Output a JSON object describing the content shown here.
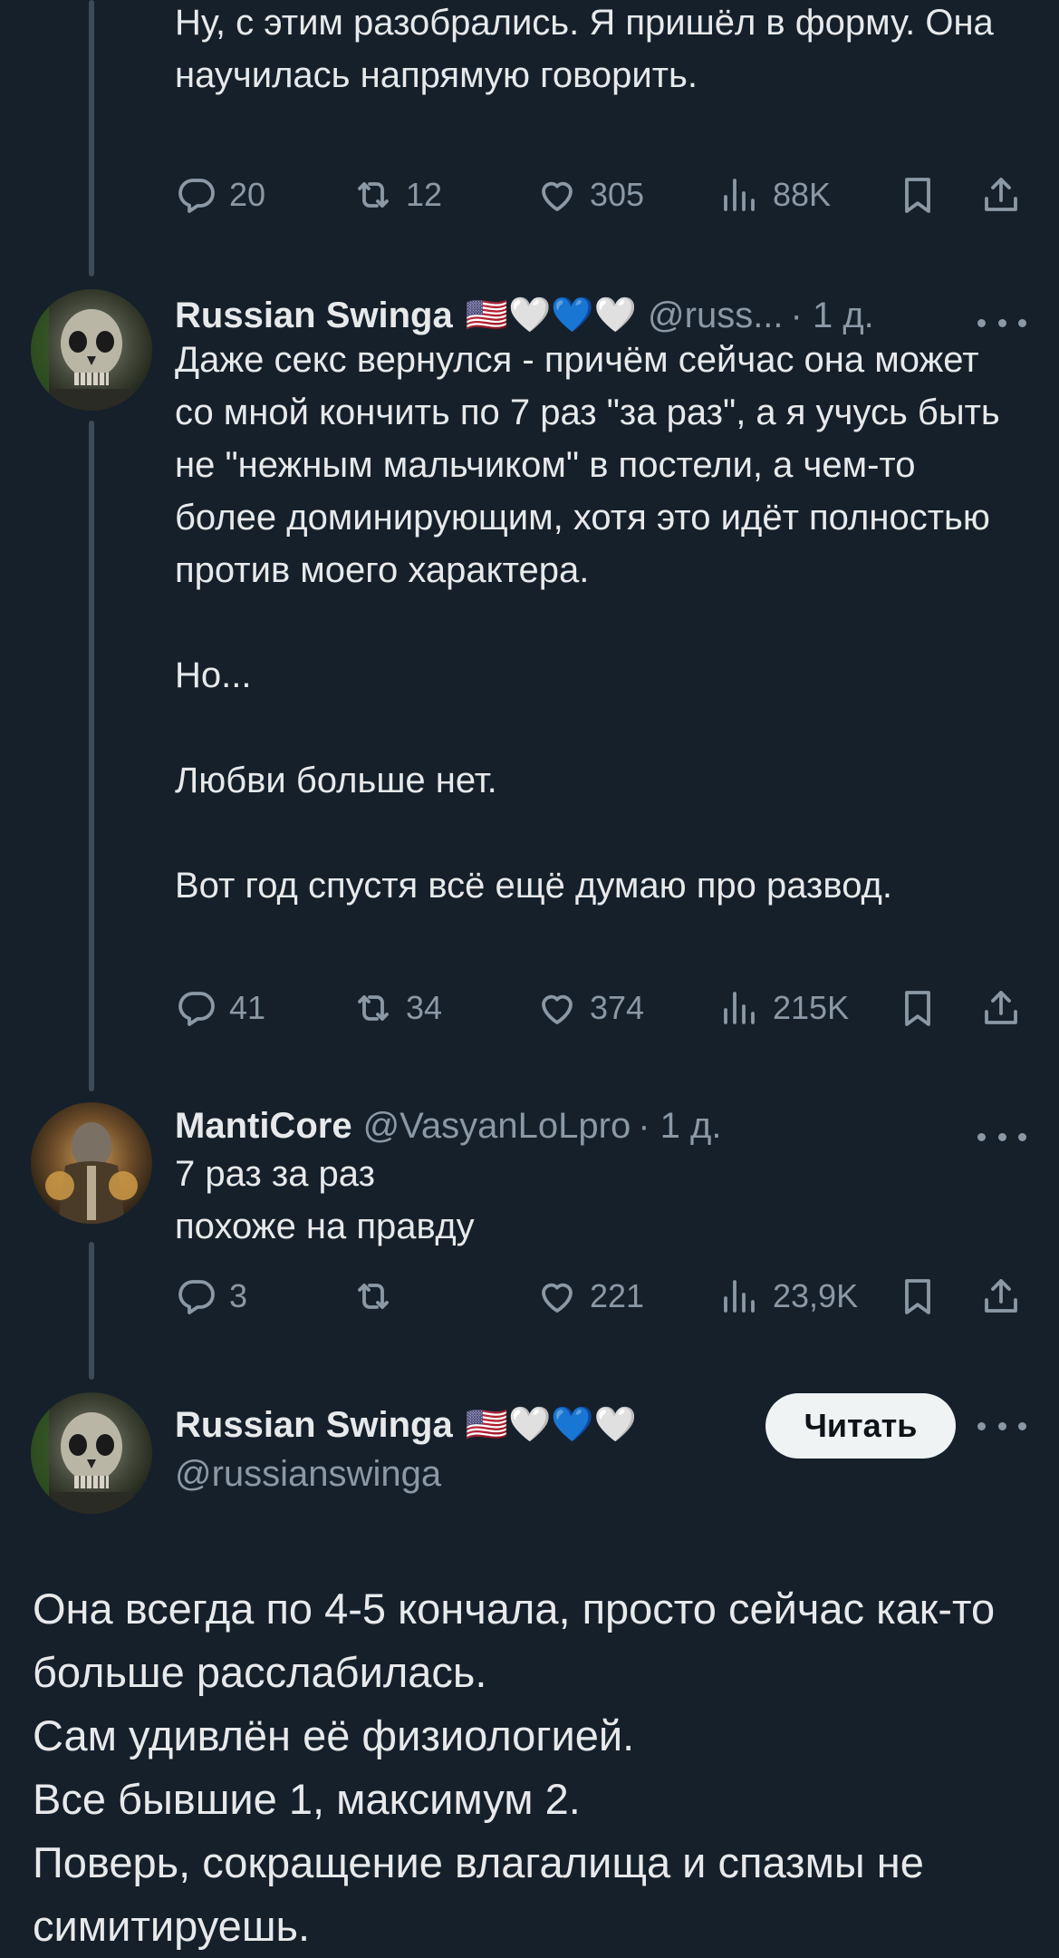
{
  "tweets": [
    {
      "text": "Ну, с этим разобрались. Я пришёл в форму. Она научилась напрямую говорить.",
      "counts": {
        "reply": "20",
        "retweet": "12",
        "like": "305",
        "views": "88K"
      }
    },
    {
      "name": "Russian Swinga",
      "flags": "🇺🇸🤍💙🤍",
      "handle": "@russ...",
      "time": "· 1 д.",
      "text": "Даже секс вернулся - причём сейчас она может со мной кончить по 7 раз \"за раз\", а я учусь быть не \"нежным мальчиком\" в постели, а чем-то более доминирующим, хотя это идёт полностью против моего характера.\n\nНо...\n\nЛюбви больше нет.\n\nВот год спустя всё ещё думаю про развод.",
      "counts": {
        "reply": "41",
        "retweet": "34",
        "like": "374",
        "views": "215K"
      }
    },
    {
      "name": "MantiCore",
      "handle": "@VasyanLoLpro",
      "time": "· 1 д.",
      "text": "7 раз за раз\nпохоже на правду",
      "counts": {
        "reply": "3",
        "retweet": "",
        "like": "221",
        "views": "23,9K"
      }
    }
  ],
  "main_tweet": {
    "name": "Russian Swinga",
    "flags": "🇺🇸🤍💙🤍",
    "handle": "@russianswinga",
    "follow_label": "Читать",
    "text": "Она всегда по 4-5 кончала, просто сейчас как-то больше расслабилась.\nСам удивлён её физиологией.\nВсе бывшие 1, максимум 2.\nПоверь, сокращение влагалища и спазмы не симитируешь."
  },
  "icons": [
    "reply-icon",
    "retweet-icon",
    "like-icon",
    "views-icon",
    "bookmark-icon",
    "share-icon",
    "more-icon"
  ],
  "colors": {
    "background": "#15202b",
    "muted": "#8b98a5",
    "text": "#e7e9ea",
    "thread": "#3d4a57"
  }
}
